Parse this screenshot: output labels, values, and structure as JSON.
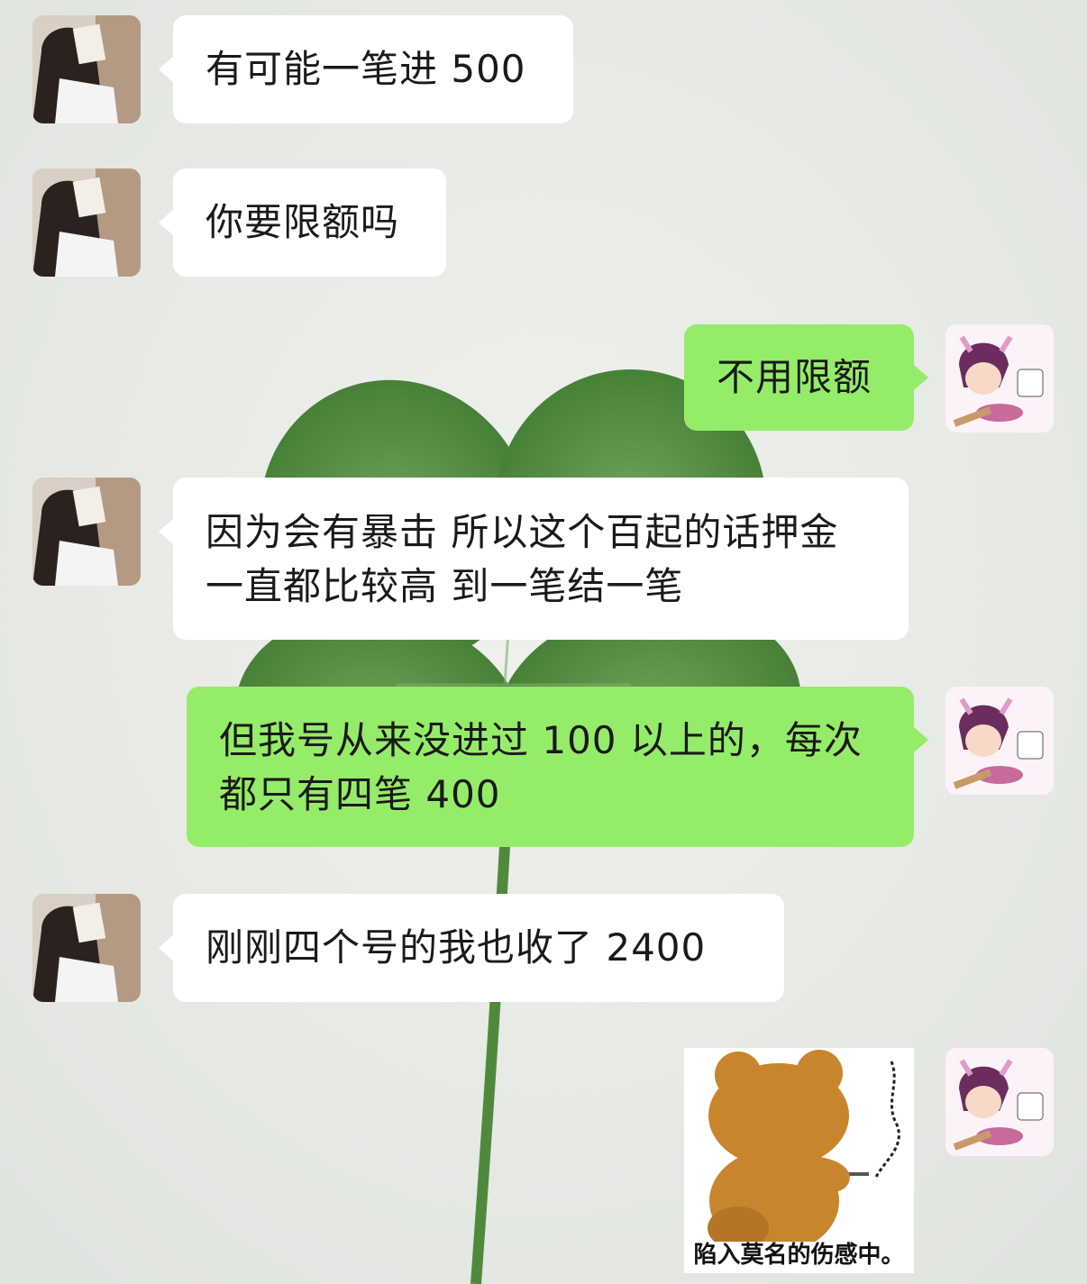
{
  "messages": [
    {
      "side": "in",
      "text": "有可能一笔进 500"
    },
    {
      "side": "in",
      "text": "你要限额吗"
    },
    {
      "side": "out",
      "text": "不用限额"
    },
    {
      "side": "in",
      "line1": "因为会有暴击 所以这个百起的话押金",
      "line2": "一直都比较高 到一笔结一笔"
    },
    {
      "side": "out",
      "line1": "但我号从来没进过 100 以上的，每次",
      "line2": "都只有四笔 400"
    },
    {
      "side": "in",
      "text": "刚刚四个号的我也收了 2400"
    }
  ],
  "sticker": {
    "caption": "陷入莫名的伤感中。"
  },
  "colors": {
    "incoming_bubble": "#ffffff",
    "outgoing_bubble": "#95ec69",
    "background": "#e7eae6"
  }
}
